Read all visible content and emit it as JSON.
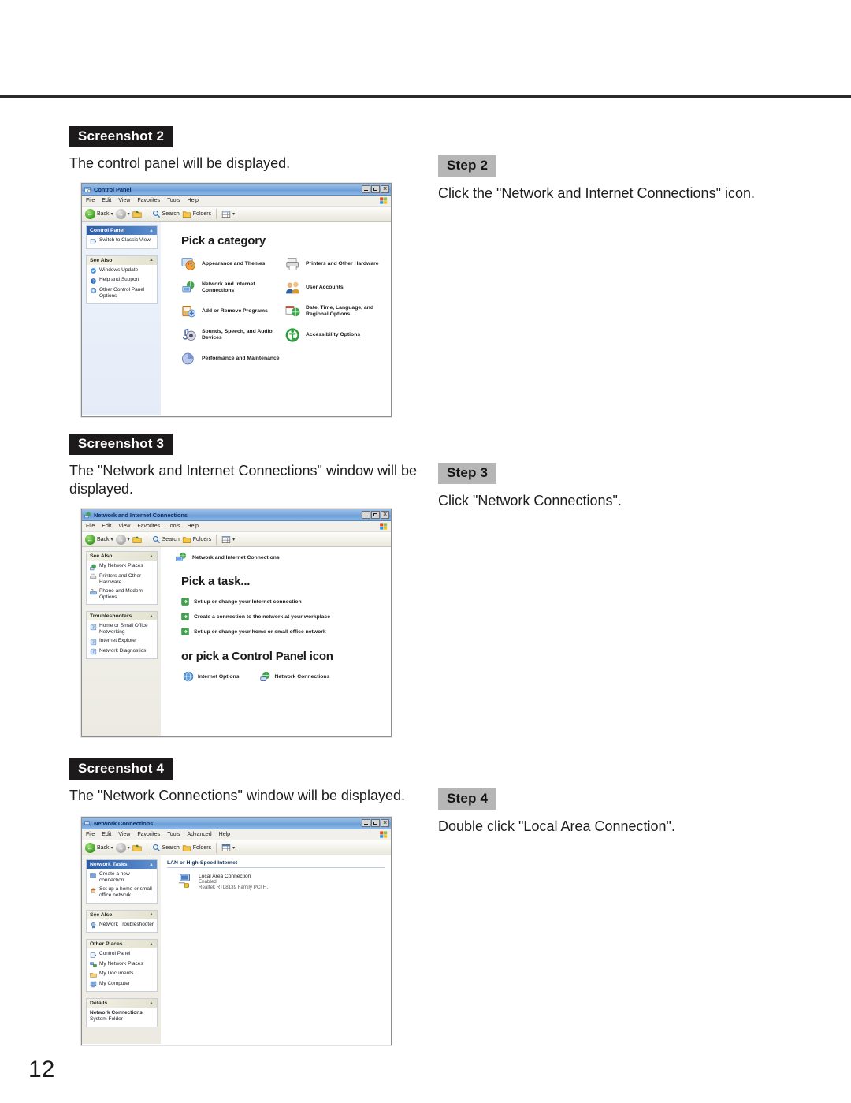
{
  "page": {
    "number": "12"
  },
  "sections": [
    {
      "badge": "Screenshot 2",
      "caption": "The control panel will be displayed.",
      "step_badge": "Step 2",
      "step_text": "Click the \"Network and Internet Connections\" icon."
    },
    {
      "badge": "Screenshot 3",
      "caption": "The \"Network and Internet Connections\" window will be displayed.",
      "step_badge": "Step 3",
      "step_text": "Click \"Network Connections\"."
    },
    {
      "badge": "Screenshot 4",
      "caption": "The \"Network Connections\" window will be displayed.",
      "step_badge": "Step 4",
      "step_text": "Double click \"Local Area Connection\"."
    }
  ],
  "window_control_panel": {
    "title": "Control Panel",
    "menu": [
      "File",
      "Edit",
      "View",
      "Favorites",
      "Tools",
      "Help"
    ],
    "toolbar": {
      "back": "Back",
      "search": "Search",
      "folders": "Folders"
    },
    "sidebar": {
      "panel1_title": "Control Panel",
      "panel1_items": [
        "Switch to Classic View"
      ],
      "panel2_title": "See Also",
      "panel2_items": [
        "Windows Update",
        "Help and Support",
        "Other Control Panel Options"
      ]
    },
    "heading": "Pick a category",
    "categories": [
      "Appearance and Themes",
      "Printers and Other Hardware",
      "Network and Internet Connections",
      "User Accounts",
      "Add or Remove Programs",
      "Date, Time, Language, and Regional Options",
      "Sounds, Speech, and Audio Devices",
      "Accessibility Options",
      "Performance and Maintenance"
    ]
  },
  "window_network_internet": {
    "title": "Network and Internet Connections",
    "menu": [
      "File",
      "Edit",
      "View",
      "Favorites",
      "Tools",
      "Help"
    ],
    "toolbar": {
      "back": "Back",
      "search": "Search",
      "folders": "Folders"
    },
    "sidebar": {
      "panel1_title": "See Also",
      "panel1_items": [
        "My Network Places",
        "Printers and Other Hardware",
        "Phone and Modem Options"
      ],
      "panel2_title": "Troubleshooters",
      "panel2_items": [
        "Home or Small Office Networking",
        "Internet Explorer",
        "Network Diagnostics"
      ]
    },
    "breadcrumb": "Network and Internet Connections",
    "heading": "Pick a task...",
    "tasks": [
      "Set up or change your Internet connection",
      "Create a connection to the network at your workplace",
      "Set up or change your home or small office network"
    ],
    "heading2": "or pick a Control Panel icon",
    "cp_icons": [
      "Internet Options",
      "Network Connections"
    ]
  },
  "window_network_connections": {
    "title": "Network Connections",
    "menu": [
      "File",
      "Edit",
      "View",
      "Favorites",
      "Tools",
      "Advanced",
      "Help"
    ],
    "toolbar": {
      "back": "Back",
      "search": "Search",
      "folders": "Folders"
    },
    "sidebar": {
      "panel1_title": "Network Tasks",
      "panel1_items": [
        "Create a new connection",
        "Set up a home or small office network"
      ],
      "panel2_title": "See Also",
      "panel2_items": [
        "Network Troubleshooter"
      ],
      "panel3_title": "Other Places",
      "panel3_items": [
        "Control Panel",
        "My Network Places",
        "My Documents",
        "My Computer"
      ],
      "panel4_title": "Details",
      "panel4_name": "Network Connections",
      "panel4_sub": "System Folder"
    },
    "group_header": "LAN or High-Speed Internet",
    "connection": {
      "name": "Local Area Connection",
      "status": "Enabled",
      "device": "Realtek RTL8139 Family PCI F..."
    }
  },
  "colors": {
    "badge_dark": "#1c1a1a",
    "badge_gray": "#b6b6b6",
    "title_blue": "#7ba9dd",
    "panel_blue": "#2a5ca8"
  }
}
